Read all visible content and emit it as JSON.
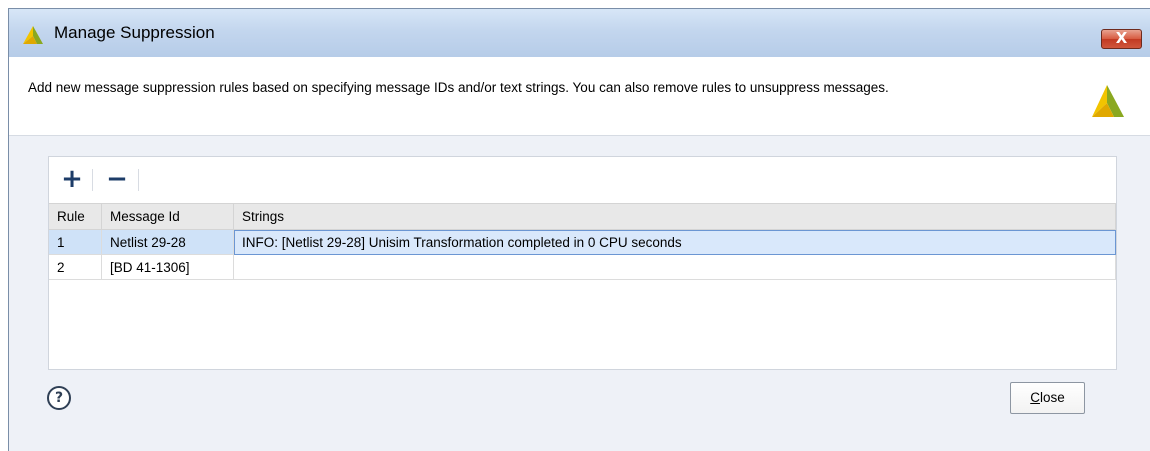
{
  "window": {
    "title": "Manage Suppression",
    "close_glyph": "X"
  },
  "header": {
    "description": "Add new message suppression rules based on specifying message IDs and/or text strings. You can also remove rules to unsuppress messages.",
    "logo_icon": "vivado-logo-icon"
  },
  "toolbar": {
    "add_glyph": "+",
    "remove_glyph": "−"
  },
  "table": {
    "columns": [
      "Rule",
      "Message Id",
      "Strings"
    ],
    "rows": [
      {
        "rule": "1",
        "message_id": "Netlist 29-28",
        "strings": "INFO: [Netlist 29-28] Unisim Transformation completed in 0 CPU seconds",
        "selected": true
      },
      {
        "rule": "2",
        "message_id": "[BD 41-1306]",
        "strings": "",
        "selected": false
      }
    ]
  },
  "footer": {
    "help_glyph": "?",
    "close_label": "Close",
    "close_mnemonic": "C"
  },
  "colors": {
    "selection": "#cfe2f8",
    "logo_yellow": "#f2c400",
    "logo_green": "#8aa820"
  }
}
